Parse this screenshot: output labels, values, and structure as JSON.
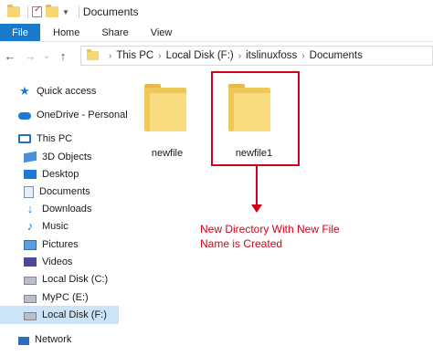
{
  "window": {
    "title": "Documents"
  },
  "ribbon": {
    "tabs": [
      "File",
      "Home",
      "Share",
      "View"
    ]
  },
  "nav": {
    "back": "←",
    "forward": "→",
    "recent": "⌄",
    "up": "↑"
  },
  "address": {
    "crumbs": [
      "This PC",
      "Local Disk (F:)",
      "itslinuxfoss",
      "Documents"
    ]
  },
  "sidebar": {
    "items": [
      {
        "label": "Quick access",
        "icon": "star-icon"
      },
      {
        "label": "OneDrive - Personal",
        "icon": "cloud-icon"
      },
      {
        "label": "This PC",
        "icon": "computer-icon"
      },
      {
        "label": "3D Objects",
        "icon": "cube-icon"
      },
      {
        "label": "Desktop",
        "icon": "desktop-icon"
      },
      {
        "label": "Documents",
        "icon": "document-icon"
      },
      {
        "label": "Downloads",
        "icon": "download-icon"
      },
      {
        "label": "Music",
        "icon": "music-icon"
      },
      {
        "label": "Pictures",
        "icon": "picture-icon"
      },
      {
        "label": "Videos",
        "icon": "video-icon"
      },
      {
        "label": "Local Disk (C:)",
        "icon": "disk-icon"
      },
      {
        "label": "MyPC (E:)",
        "icon": "disk-icon"
      },
      {
        "label": "Local Disk (F:)",
        "icon": "disk-icon",
        "selected": true
      },
      {
        "label": "Network",
        "icon": "network-icon"
      }
    ]
  },
  "files": [
    {
      "name": "newfile",
      "type": "folder"
    },
    {
      "name": "newfile1",
      "type": "folder",
      "highlighted": true
    }
  ],
  "annotation": {
    "line1": "New Directory With New File",
    "line2": "Name is Created"
  },
  "colors": {
    "accent": "#1979ca",
    "annotation": "#d0021b",
    "folder": "#f9dc7f",
    "selected": "#cce4f7"
  }
}
